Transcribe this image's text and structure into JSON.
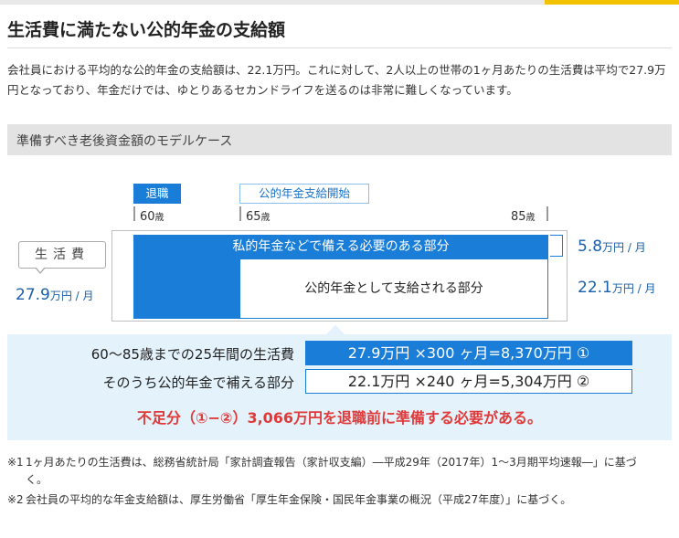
{
  "title": "生活費に満たない公的年金の支給額",
  "intro": "会社員における平均的な公的年金の支給額は、22.1万円。これに対して、2人以上の世帯の1ヶ月あたりの生活費は平均で27.9万円となっており、年金だけでは、ゆとりあるセカンドライフを送るのは非常に難しくなっています。",
  "model_case_heading": "準備すべき老後資金額のモデルケース",
  "timeline": {
    "retire_tag": "退職",
    "pension_tag": "公的年金支給開始",
    "age_60": "60",
    "age_65": "65",
    "age_85": "85",
    "age_unit": "歳"
  },
  "living_cost": {
    "label": "生活費",
    "amount": "27.9",
    "unit": "万円 / 月"
  },
  "bars": {
    "private_label": "私的年金などで備える必要のある部分",
    "public_label": "公的年金として支給される部分",
    "private_amount": "5.8",
    "private_unit": "万円 / 月",
    "public_amount": "22.1",
    "public_unit": "万円 / 月"
  },
  "calc": {
    "row1_label": "60～85歳までの25年間の生活費",
    "row1_value": "27.9万円 ×300 ヶ月=8,370万円 ①",
    "row2_label": "そのうち公的年金で補える部分",
    "row2_value": "22.1万円 ×240 ヶ月=5,304万円 ②",
    "shortage": "不足分（①−②）3,066万円を退職前に準備する必要がある。"
  },
  "notes": [
    {
      "mark": "※1",
      "text": "1ヶ月あたりの生活費は、総務省統計局「家計調査報告（家計収支編）―平成29年（2017年）1～3月期平均速報―」に基づく。"
    },
    {
      "mark": "※2",
      "text": "会社員の平均的な年金支給額は、厚生労働省「厚生年金保険・国民年金事業の概況（平成27年度）」に基づく。"
    }
  ],
  "colors": {
    "accent_blue": "#1a7ed8",
    "amount_blue": "#1a5fa8",
    "light_blue_bg": "#e3f2fb",
    "warning_red": "#e03a3a",
    "header_yellow": "#f2c200"
  }
}
